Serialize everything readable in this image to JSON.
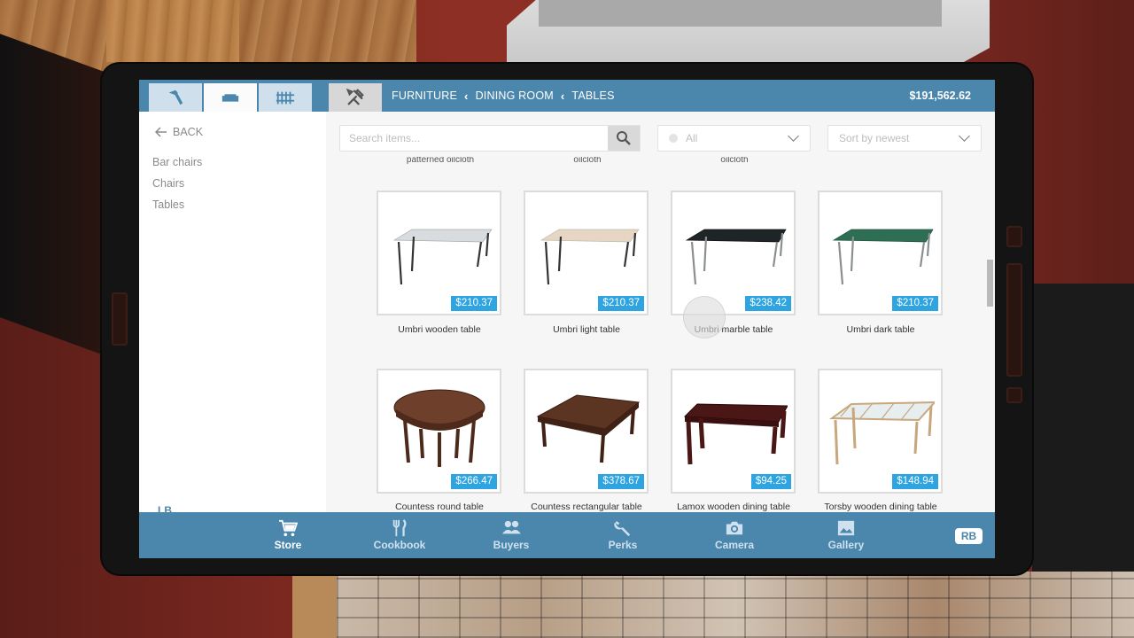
{
  "topbar": {
    "tabs": [
      {
        "icon": "hammer-icon",
        "active": false
      },
      {
        "icon": "sofa-icon",
        "active": true
      },
      {
        "icon": "fence-icon",
        "active": false
      },
      {
        "icon": "tools-icon",
        "active": false
      }
    ],
    "breadcrumb": [
      "FURNITURE",
      "DINING ROOM",
      "TABLES"
    ],
    "money": "$191,562.62"
  },
  "sidebar": {
    "back_label": "BACK",
    "categories": [
      "Bar chairs",
      "Chairs",
      "Tables"
    ],
    "lb_label": "LB"
  },
  "filters": {
    "search_placeholder": "Search items...",
    "category_value": "All",
    "sort_value": "Sort by newest"
  },
  "previous_row_names": [
    "patterned oilcloth",
    "oilcloth",
    "oilcloth"
  ],
  "items": [
    {
      "name": "Umbri wooden table",
      "price": "$210.37",
      "top": "#d9dcde",
      "leg": "#333"
    },
    {
      "name": "Umbri light table",
      "price": "$210.37",
      "top": "#e7d6c4",
      "leg": "#333"
    },
    {
      "name": "Umbri marble table",
      "price": "$238.42",
      "top": "#1f2426",
      "leg": "#8a8f92"
    },
    {
      "name": "Umbri dark table",
      "price": "$210.37",
      "top": "#2e6e55",
      "leg": "#8a8f92"
    },
    {
      "name": "Countess round table",
      "price": "$266.47"
    },
    {
      "name": "Countess rectangular table",
      "price": "$378.67"
    },
    {
      "name": "Lamox wooden dining table",
      "price": "$94.25"
    },
    {
      "name": "Torsby wooden dining table",
      "price": "$148.94"
    }
  ],
  "bottom_nav": {
    "items": [
      {
        "label": "Store",
        "icon": "cart-icon",
        "active": true
      },
      {
        "label": "Cookbook",
        "icon": "cutlery-icon",
        "active": false
      },
      {
        "label": "Buyers",
        "icon": "people-icon",
        "active": false
      },
      {
        "label": "Perks",
        "icon": "wrench-icon",
        "active": false
      },
      {
        "label": "Camera",
        "icon": "camera-icon",
        "active": false
      },
      {
        "label": "Gallery",
        "icon": "picture-icon",
        "active": false
      }
    ],
    "rb_label": "RB"
  },
  "colors": {
    "bar": "#4b86ad",
    "price_tag": "#2ea4e0"
  }
}
